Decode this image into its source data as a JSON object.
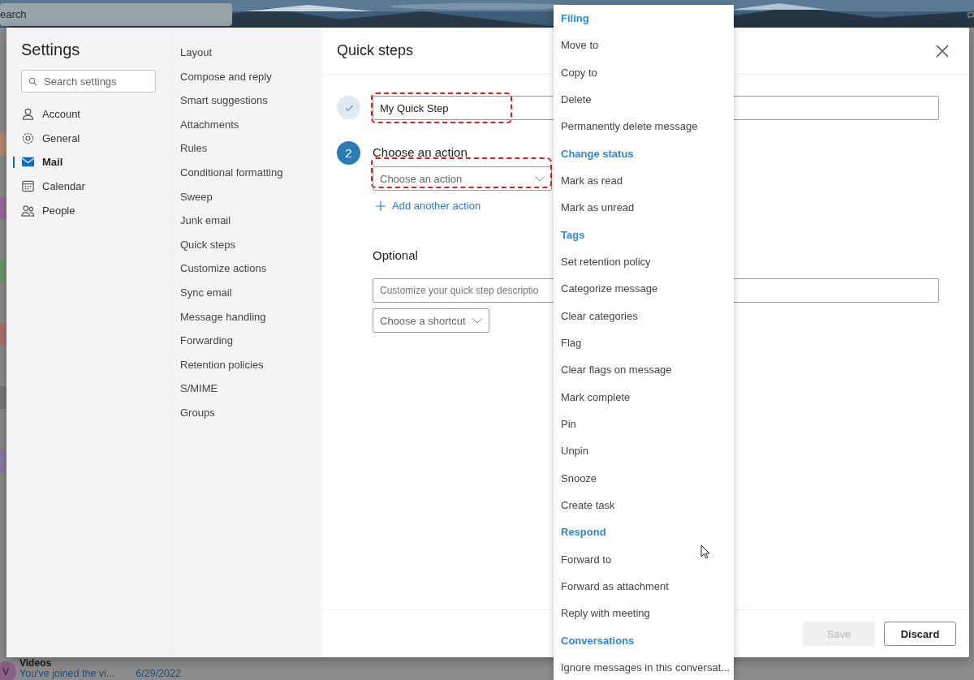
{
  "background_app": {
    "search": {
      "value": "earch"
    },
    "message": {
      "avatar": "V",
      "sender": "Videos",
      "preview": "You've joined the vi...",
      "date": "6/29/2022"
    }
  },
  "settings": {
    "title": "Settings",
    "search": {
      "placeholder": "Search settings"
    },
    "nav": [
      {
        "label": "Account",
        "kind": "person",
        "selected": false
      },
      {
        "label": "General",
        "kind": "gear",
        "selected": false
      },
      {
        "label": "Mail",
        "kind": "mail",
        "selected": true
      },
      {
        "label": "Calendar",
        "kind": "calendar",
        "selected": false
      },
      {
        "label": "People",
        "kind": "people",
        "selected": false
      }
    ],
    "subnav": [
      "Layout",
      "Compose and reply",
      "Smart suggestions",
      "Attachments",
      "Rules",
      "Conditional formatting",
      "Sweep",
      "Junk email",
      "Quick steps",
      "Customize actions",
      "Sync email",
      "Message handling",
      "Forwarding",
      "Retention policies",
      "S/MIME",
      "Groups"
    ]
  },
  "panel": {
    "title": "Quick steps",
    "name_step": {
      "completed": true,
      "value": "My Quick Step",
      "highlighted": true
    },
    "action_step": {
      "completed": false,
      "number": "2",
      "label": "Choose an action",
      "select": {
        "placeholder": "Choose an action",
        "highlighted": true
      },
      "add_link": "Add another action"
    },
    "optional": {
      "label": "Optional",
      "description": {
        "placeholder": "Customize your quick step descriptio"
      },
      "shortcut": {
        "placeholder": "Choose a shortcut"
      }
    },
    "buttons": [
      {
        "label": "Save",
        "disabled": true
      },
      {
        "label": "Discard",
        "disabled": false
      }
    ]
  },
  "action_menu": [
    {
      "kind": "header",
      "label": "Filing"
    },
    {
      "kind": "item",
      "label": "Move to"
    },
    {
      "kind": "item",
      "label": "Copy to"
    },
    {
      "kind": "item",
      "label": "Delete"
    },
    {
      "kind": "item",
      "label": "Permanently delete message"
    },
    {
      "kind": "header",
      "label": "Change status"
    },
    {
      "kind": "item",
      "label": "Mark as read"
    },
    {
      "kind": "item",
      "label": "Mark as unread"
    },
    {
      "kind": "header",
      "label": "Tags"
    },
    {
      "kind": "item",
      "label": "Set retention policy"
    },
    {
      "kind": "item",
      "label": "Categorize message"
    },
    {
      "kind": "item",
      "label": "Clear categories"
    },
    {
      "kind": "item",
      "label": "Flag"
    },
    {
      "kind": "item",
      "label": "Clear flags on message"
    },
    {
      "kind": "item",
      "label": "Mark complete"
    },
    {
      "kind": "item",
      "label": "Pin"
    },
    {
      "kind": "item",
      "label": "Unpin"
    },
    {
      "kind": "item",
      "label": "Snooze"
    },
    {
      "kind": "item",
      "label": "Create task"
    },
    {
      "kind": "header",
      "label": "Respond"
    },
    {
      "kind": "item",
      "label": "Forward to"
    },
    {
      "kind": "item",
      "label": "Forward as attachment"
    },
    {
      "kind": "item",
      "label": "Reply with meeting"
    },
    {
      "kind": "header",
      "label": "Conversations"
    },
    {
      "kind": "item",
      "label": "Ignore messages in this conversat..."
    }
  ]
}
